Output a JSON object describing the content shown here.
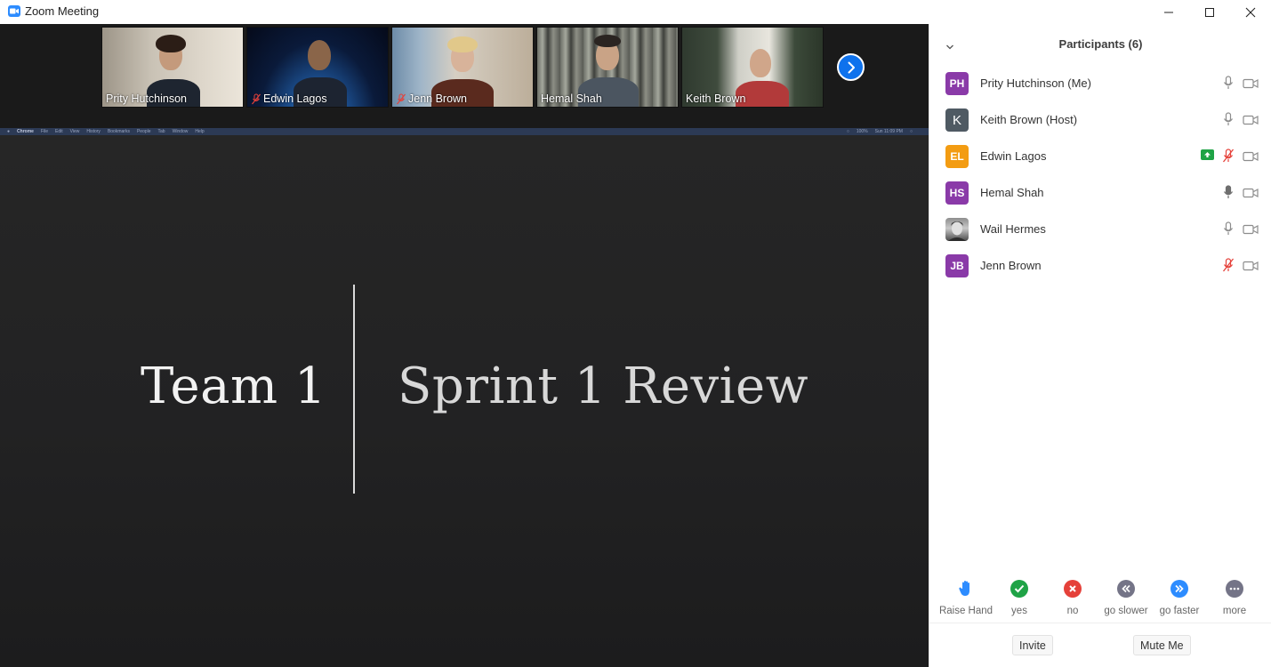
{
  "window": {
    "title": "Zoom Meeting",
    "icon": "zoom-camera-icon"
  },
  "video_strip": {
    "tiles": [
      {
        "name": "Prity Hutchinson",
        "muted": false
      },
      {
        "name": "Edwin Lagos",
        "muted": true
      },
      {
        "name": "Jenn Brown",
        "muted": true
      },
      {
        "name": "Hemal Shah",
        "muted": false
      },
      {
        "name": "Keith Brown",
        "muted": false
      }
    ],
    "next_icon": "chevron-right-icon"
  },
  "shared_screen": {
    "menubar_left": [
      "Chrome",
      "File",
      "Edit",
      "View",
      "History",
      "Bookmarks",
      "People",
      "Tab",
      "Window",
      "Help"
    ],
    "menubar_right": [
      "100%",
      "Sun 11:09 PM"
    ],
    "slide_left": "Team 1",
    "slide_right": "Sprint 1 Review"
  },
  "participants": {
    "title": "Participants (6)",
    "list": [
      {
        "initials": "PH",
        "name": "Prity Hutchinson (Me)",
        "avatar_color": "#8a3aa8",
        "mic": "on",
        "sharing": false
      },
      {
        "initials": "K",
        "name": "Keith Brown (Host)",
        "avatar_color": "#4f5a63",
        "mic": "on",
        "sharing": false
      },
      {
        "initials": "EL",
        "name": "Edwin Lagos",
        "avatar_color": "#f39c12",
        "mic": "muted",
        "sharing": true
      },
      {
        "initials": "HS",
        "name": "Hemal Shah",
        "avatar_color": "#8a3aa8",
        "mic": "on-dark",
        "sharing": false
      },
      {
        "initials": "",
        "name": "Wail Hermes",
        "avatar_color": "#6b6b6b",
        "mic": "on",
        "sharing": false
      },
      {
        "initials": "JB",
        "name": "Jenn Brown",
        "avatar_color": "#8a3aa8",
        "mic": "muted",
        "sharing": false
      }
    ]
  },
  "reactions": [
    {
      "label": "Raise Hand",
      "icon": "raise-hand-icon",
      "color": "#2d8cff"
    },
    {
      "label": "yes",
      "icon": "check-icon",
      "color": "#1fa346"
    },
    {
      "label": "no",
      "icon": "x-icon",
      "color": "#e5413a"
    },
    {
      "label": "go slower",
      "icon": "rewind-icon",
      "color": "#747487"
    },
    {
      "label": "go faster",
      "icon": "fast-forward-icon",
      "color": "#2d8cff"
    },
    {
      "label": "more",
      "icon": "more-icon",
      "color": "#747487"
    }
  ],
  "footer": {
    "invite_label": "Invite",
    "mute_me_label": "Mute Me"
  }
}
